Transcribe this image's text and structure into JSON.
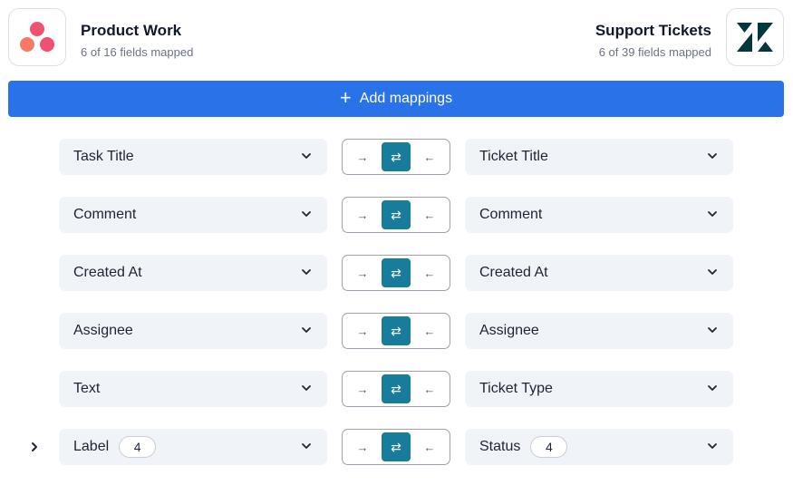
{
  "source_app": {
    "name": "Product Work",
    "mapped": "6 of 16 fields mapped",
    "icon": "asana-logo-icon"
  },
  "target_app": {
    "name": "Support Tickets",
    "mapped": "6 of 39 fields mapped",
    "icon": "zendesk-logo-icon"
  },
  "add_button": {
    "label": "Add mappings",
    "icon": "plus-icon"
  },
  "colors": {
    "primary": "#2a72e8",
    "teal": "#177d9c",
    "field_bg": "#f0f3f7"
  },
  "direction_glyphs": {
    "to_right": "→",
    "both": "⇄",
    "to_left": "←"
  },
  "mappings": [
    {
      "left": "Task Title",
      "right": "Ticket Title"
    },
    {
      "left": "Comment",
      "right": "Comment"
    },
    {
      "left": "Created At",
      "right": "Created At"
    },
    {
      "left": "Assignee",
      "right": "Assignee"
    },
    {
      "left": "Text",
      "right": "Ticket Type"
    },
    {
      "left": "Label",
      "left_count": "4",
      "right": "Status",
      "right_count": "4"
    }
  ]
}
